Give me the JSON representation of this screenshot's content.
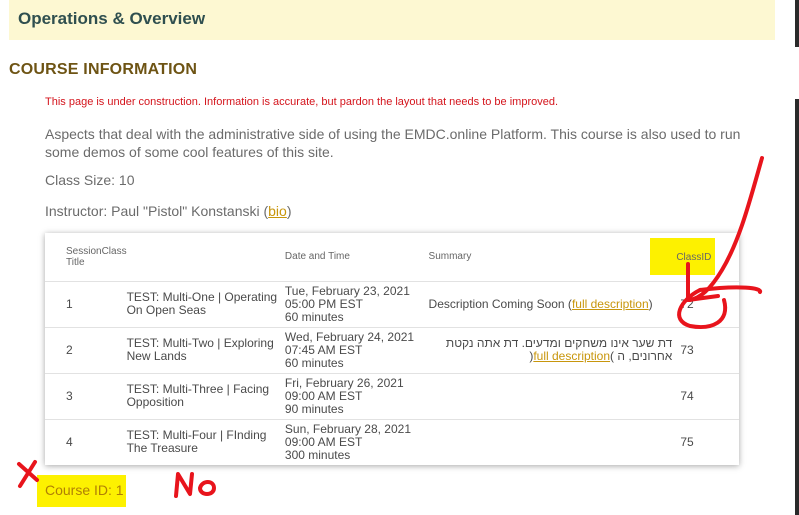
{
  "header": {
    "title": "Operations & Overview"
  },
  "section": {
    "heading": "COURSE INFORMATION"
  },
  "notice": "This page is under construction. Information is accurate, but pardon the layout that needs to be improved.",
  "description": "Aspects that deal with the administrative side of using the EMDC.online Platform. This course is also used to run some demos of some cool features of this site.",
  "class_size": "Class Size: 10",
  "instructor": {
    "prefix": "Instructor: Paul \"Pistol\" Konstanski (",
    "link": "bio",
    "suffix": ")"
  },
  "table": {
    "headers": {
      "session": "Session",
      "title": "Class Title",
      "date": "Date and Time",
      "summary": "Summary",
      "classid": "ClassID"
    },
    "rows": [
      {
        "session": "1",
        "title": "TEST: Multi-One | Operating On Open Seas",
        "date": [
          "Tue, February 23, 2021",
          "05:00 PM EST",
          "60 minutes"
        ],
        "summary": "Description Coming Soon (",
        "link": "full description",
        "summary_end": ")",
        "classid": "72"
      },
      {
        "session": "2",
        "title": "TEST: Multi-Two | Exploring New Lands",
        "date": [
          "Wed, February 24, 2021",
          "07:45 AM EST",
          "60 minutes"
        ],
        "summary": "דת שער אינו משחקים ומדעים. דת אתה נקטת אחרונים, ה",
        "link": "full description",
        "summary_end": ")",
        "summary_start": "(",
        "classid": "73"
      },
      {
        "session": "3",
        "title": "TEST: Multi-Three | Facing Opposition",
        "date": [
          "Fri, February 26, 2021",
          "09:00 AM EST",
          "90 minutes"
        ],
        "summary": "",
        "link": "",
        "summary_end": "",
        "classid": "74"
      },
      {
        "session": "4",
        "title": "TEST: Multi-Four | FInding The Treasure",
        "date": [
          "Sun, February 28, 2021",
          "09:00 AM EST",
          "300 minutes"
        ],
        "summary": "",
        "link": "",
        "summary_end": "",
        "classid": "75"
      }
    ]
  },
  "course_id": "Course ID: 1",
  "annotations": {
    "no_text": "No",
    "x_mark": "X",
    "color": "#e8141c",
    "highlight": "#fdf100"
  }
}
